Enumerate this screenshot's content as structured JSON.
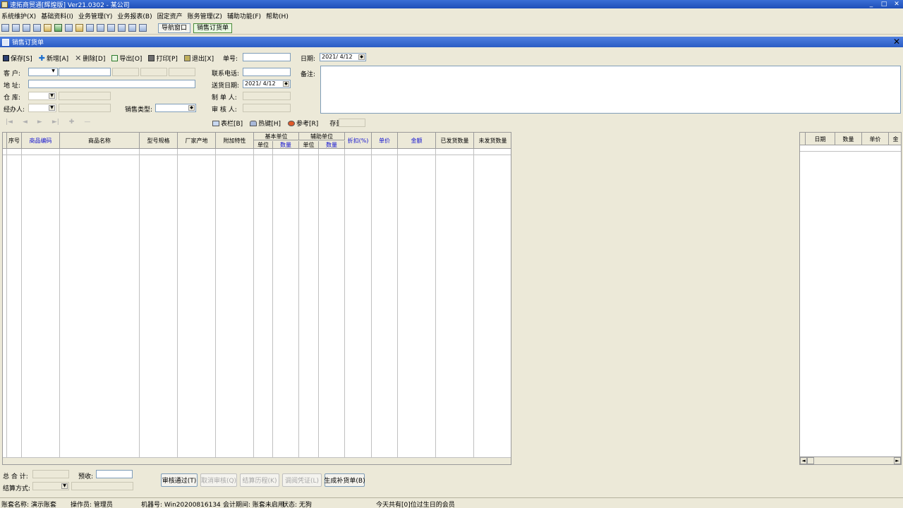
{
  "window": {
    "title": "速拓商贸通[辉煌版] Ver21.0302 - 某公司"
  },
  "menu": [
    "系统维护(X)",
    "基础资料(I)",
    "业务管理(Y)",
    "业务报表(B)",
    "固定资产",
    "账务管理(Z)",
    "辅助功能(F)",
    "帮助(H)"
  ],
  "toolbar": {
    "tabs": [
      "导航窗口",
      "销售订货单"
    ]
  },
  "child": {
    "title": "销售订货单"
  },
  "actions": {
    "save": "保存[S]",
    "add": "新增[A]",
    "delete": "删除[D]",
    "export": "导出[O]",
    "print": "打印[P]",
    "exit": "退出[X]"
  },
  "form": {
    "order_no_label": "单号:",
    "order_no": "",
    "date_label": "日期:",
    "date": "2021/ 4/12",
    "customer_label": "客  户:",
    "address_label": "地  址:",
    "warehouse_label": "仓  库:",
    "handler_label": "经办人:",
    "sales_type_label": "销售类型:",
    "phone_label": "联系电话:",
    "delivery_date_label": "送货日期:",
    "delivery_date": "2021/ 4/12",
    "maker_label": "制 单 人:",
    "auditor_label": "审 核 人:",
    "remark_label": "备注:"
  },
  "grid_options": {
    "columns": "表栏[B]",
    "hotkey": "热键[H]",
    "reference": "参考[R]",
    "stock_label": "存量:"
  },
  "grid": {
    "headers": {
      "seq": "序号",
      "code": "商品编码",
      "name": "商品名称",
      "spec": "型号规格",
      "origin": "厂家产地",
      "extra": "附加特性",
      "base_unit": "基本单位",
      "unit": "单位",
      "qty": "数量",
      "aux_unit": "辅助单位",
      "aux_unit_sub": "单位",
      "aux_qty": "数量",
      "discount": "折扣(%)",
      "price": "单价",
      "amount": "金额",
      "shipped": "已发货数量",
      "unshipped": "未发货数量"
    }
  },
  "side_grid": {
    "headers": [
      "日期",
      "数量",
      "单价",
      "金"
    ]
  },
  "totals": {
    "total_label": "总 合 计:",
    "prepay_label": "预收:",
    "settle_label": "结算方式:"
  },
  "bottom_buttons": [
    {
      "label": "审核通过(T)",
      "enabled": true
    },
    {
      "label": "取消审核(Q)",
      "enabled": false
    },
    {
      "label": "结算历程(K)",
      "enabled": false
    },
    {
      "label": "调阅凭证(L)",
      "enabled": false
    },
    {
      "label": "生成补货单(B)",
      "enabled": true
    }
  ],
  "status": {
    "account": "账套名称: 演示账套",
    "operator": "操作员: 管理员",
    "machine": "机器号: Win20200816134",
    "period": "会计期间: 账套未启用",
    "state": "状态: 无狗",
    "birthday": "今天共有[0]位过生日的会员"
  }
}
